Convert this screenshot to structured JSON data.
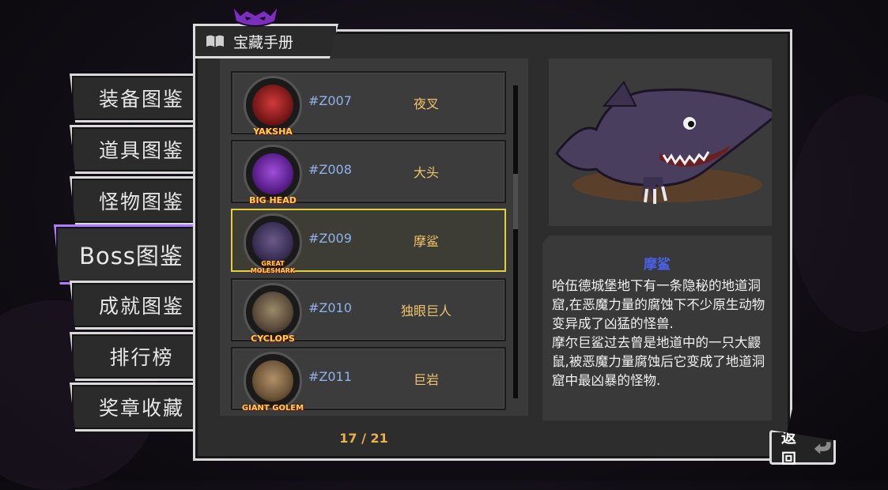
{
  "window": {
    "title": "宝藏手册"
  },
  "tabs": [
    {
      "label": "装备图鉴",
      "active": false
    },
    {
      "label": "道具图鉴",
      "active": false
    },
    {
      "label": "怪物图鉴",
      "active": false
    },
    {
      "label": "Boss图鉴",
      "active": true
    },
    {
      "label": "成就图鉴",
      "active": false
    },
    {
      "label": "排行榜",
      "active": false
    },
    {
      "label": "奖章收藏",
      "active": false
    }
  ],
  "list": [
    {
      "code": "#Z007",
      "name": "夜叉",
      "portrait_label": "YAKSHA",
      "selected": false
    },
    {
      "code": "#Z008",
      "name": "大头",
      "portrait_label": "BIG HEAD",
      "selected": false
    },
    {
      "code": "#Z009",
      "name": "摩鲨",
      "portrait_label": "GREAT MOLESHARK",
      "selected": true
    },
    {
      "code": "#Z010",
      "name": "独眼巨人",
      "portrait_label": "CYCLOPS",
      "selected": false
    },
    {
      "code": "#Z011",
      "name": "巨岩",
      "portrait_label": "GIANT GOLEM",
      "selected": false
    }
  ],
  "pagination": {
    "text": "17 / 21"
  },
  "detail": {
    "title": "摩鲨",
    "description": "哈伍德城堡地下有一条隐秘的地道洞窟,在恶魔力量的腐蚀下不少原生动物变异成了凶猛的怪兽.\n摩尔巨鲨过去曾是地道中的一只大鼹鼠,被恶魔力量腐蚀后它变成了地道洞窟中最凶暴的怪物."
  },
  "back_button": {
    "label": "返回"
  },
  "colors": {
    "selected_border": "#e6cf3c",
    "active_tab_border": "#b07cff",
    "code_text": "#8fb2ea",
    "name_text": "#f0c46a",
    "detail_title": "#4b60e8",
    "page_text": "#e9b04a"
  },
  "icons": {
    "title": "book-icon",
    "header_ornament": "demon-icon",
    "preview": "moleshark-illustration",
    "back": "return-arrow-icon"
  }
}
